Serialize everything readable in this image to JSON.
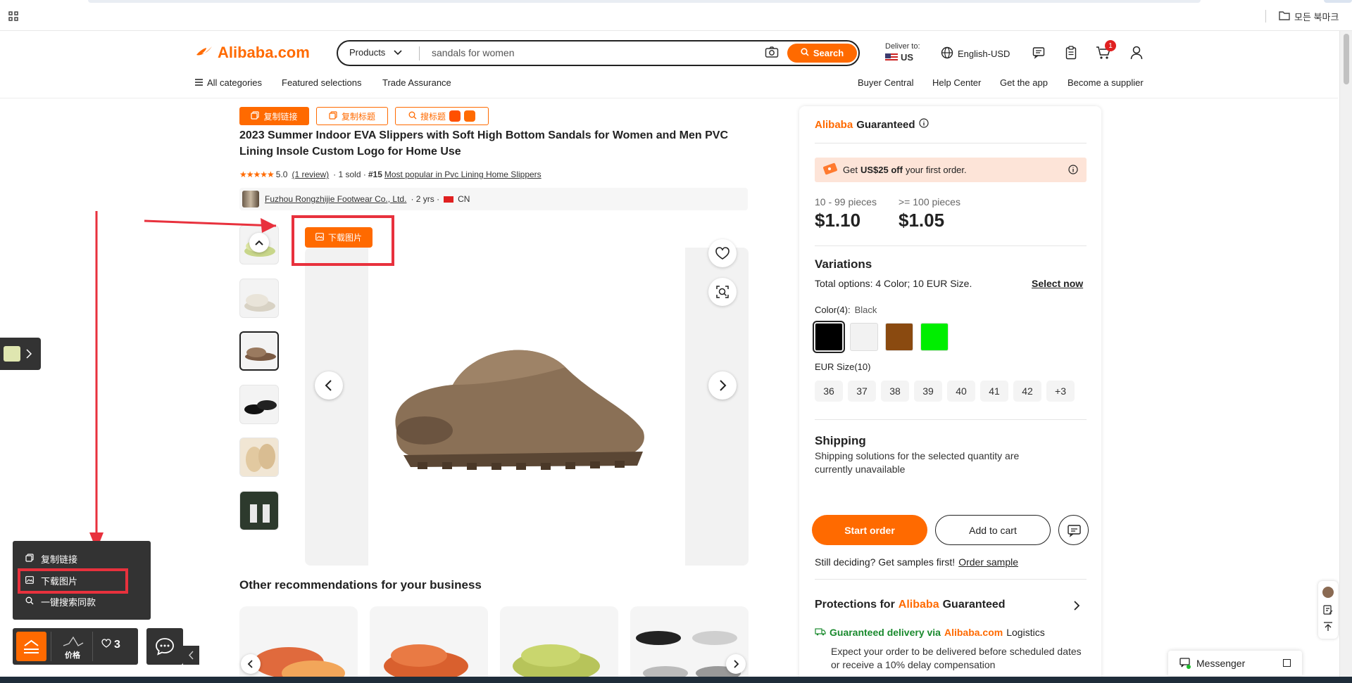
{
  "browser": {
    "bookmark_label": "모든 북마크"
  },
  "header": {
    "logo": "Alibaba.com",
    "search_category": "Products",
    "search_value": "sandals for women",
    "search_button": "Search",
    "deliver_to_label": "Deliver to:",
    "deliver_to_country": "US",
    "language": "English-USD",
    "cart_count": "1"
  },
  "subnav": {
    "all_categories": "All categories",
    "featured": "Featured selections",
    "trade_assurance": "Trade Assurance",
    "buyer_central": "Buyer Central",
    "help_center": "Help Center",
    "get_app": "Get the app",
    "become_supplier": "Become a supplier"
  },
  "extension": {
    "copy_link": "复制链接",
    "copy_title": "复制标题",
    "search_title": "搜标题",
    "download_image": "下载图片",
    "menu_copy_link": "复制链接",
    "menu_download_image": "下载图片",
    "menu_search_similar": "一键搜索同款",
    "price_label": "价格",
    "fav_count": "3"
  },
  "product": {
    "title": "2023 Summer Indoor EVA Slippers with Soft High Bottom Sandals for Women and Men PVC Lining Insole Custom Logo for Home Use",
    "rating": "5.0",
    "reviews": "(1 review)",
    "sold": "· 1 sold ·",
    "rank": "#15",
    "rank_text": "Most popular in Pvc Lining Home Slippers",
    "supplier": "Fuzhou Rongzhijie Footwear Co., Ltd.",
    "supplier_years": "· 2 yrs ·",
    "supplier_country": "CN",
    "rating_stars": 5
  },
  "sidebar": {
    "guaranteed_brand": "Alibaba",
    "guaranteed_word": "Guaranteed",
    "promo_prefix": "Get",
    "promo_amount": "US$25 off",
    "promo_suffix": "your first order.",
    "tier1_qty": "10 - 99 pieces",
    "tier1_price": "$1.10",
    "tier2_qty": ">= 100 pieces",
    "tier2_price": "$1.05",
    "variations_title": "Variations",
    "total_options": "Total options: 4 Color; 10 EUR Size.",
    "select_now": "Select now",
    "color_label": "Color(4):",
    "color_selected": "Black",
    "colors": [
      "#000000",
      "#f2f2f2",
      "#8a4a10",
      "#00ee00"
    ],
    "size_label": "EUR Size(10)",
    "sizes": [
      "36",
      "37",
      "38",
      "39",
      "40",
      "41",
      "42",
      "+3"
    ],
    "shipping_title": "Shipping",
    "shipping_text": "Shipping solutions for the selected quantity are currently unavailable",
    "start_order": "Start order",
    "add_to_cart": "Add to cart",
    "samples_text": "Still deciding? Get samples first!",
    "order_sample": "Order sample",
    "protections_prefix": "Protections for",
    "delivery_prefix": "Guaranteed delivery via",
    "delivery_brand": "Alibaba.com",
    "delivery_suffix": "Logistics",
    "delivery_text": "Expect your order to be delivered before scheduled dates or receive a 10% delay compensation"
  },
  "recommendations": {
    "title": "Other recommendations for your business"
  },
  "messenger": {
    "label": "Messenger"
  },
  "colors": {
    "accent": "#ff6a00",
    "annotation_red": "#e8313d"
  }
}
